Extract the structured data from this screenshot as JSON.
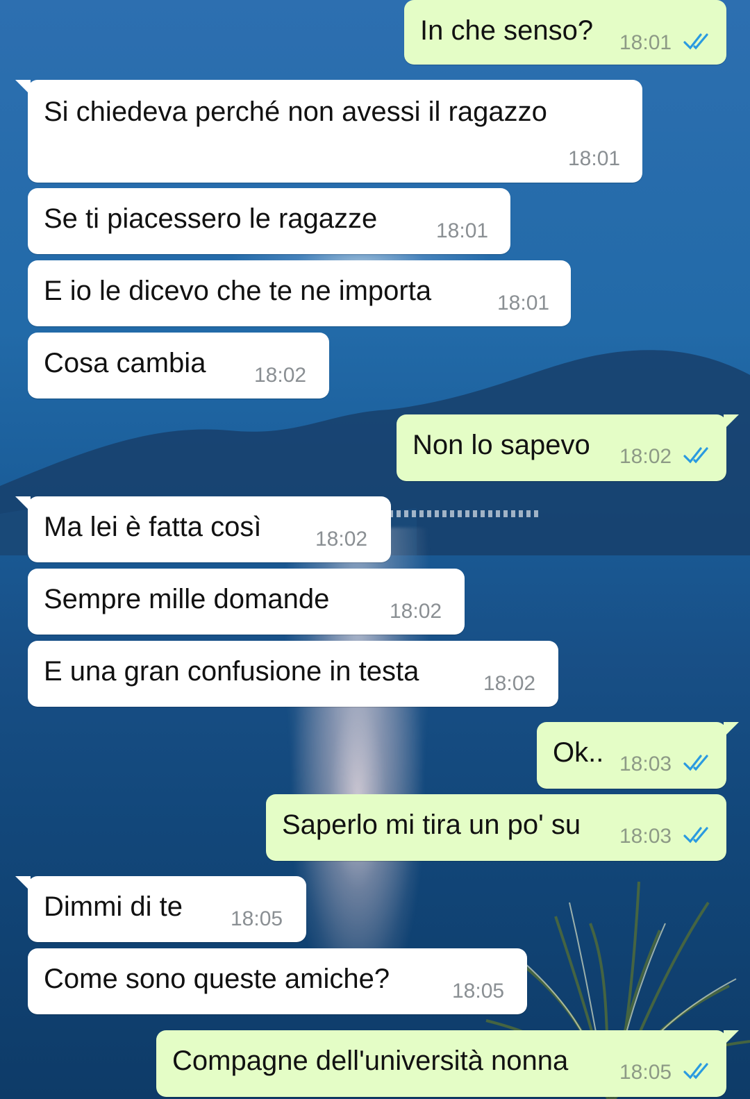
{
  "colors": {
    "incoming_bubble": "#ffffff",
    "outgoing_bubble": "#e4fdc6",
    "read_ticks": "#2a9ae0",
    "time_text": "#8a8f93"
  },
  "icons": {
    "read_receipt": "double-check-icon"
  },
  "messages": [
    {
      "direction": "out",
      "text": "In che senso?",
      "time": "18:01",
      "status": "read"
    },
    {
      "direction": "in",
      "text": "Si chiedeva perché non avessi il ragazzo",
      "time": "18:01"
    },
    {
      "direction": "in",
      "text": "Se ti piacessero le ragazze",
      "time": "18:01"
    },
    {
      "direction": "in",
      "text": "E io le dicevo che te ne importa",
      "time": "18:01"
    },
    {
      "direction": "in",
      "text": "Cosa cambia",
      "time": "18:02"
    },
    {
      "direction": "out",
      "text": "Non lo sapevo",
      "time": "18:02",
      "status": "read"
    },
    {
      "direction": "in",
      "text": "Ma lei è fatta così",
      "time": "18:02"
    },
    {
      "direction": "in",
      "text": "Sempre mille domande",
      "time": "18:02"
    },
    {
      "direction": "in",
      "text": "E una gran confusione in testa",
      "time": "18:02"
    },
    {
      "direction": "out",
      "text": "Ok..",
      "time": "18:03",
      "status": "read"
    },
    {
      "direction": "out",
      "text": "Saperlo mi tira un po' su",
      "time": "18:03",
      "status": "read"
    },
    {
      "direction": "in",
      "text": "Dimmi di te",
      "time": "18:05"
    },
    {
      "direction": "in",
      "text": "Come sono queste amiche?",
      "time": "18:05"
    },
    {
      "direction": "out",
      "text": "Compagne dell'università nonna",
      "time": "18:05",
      "status": "read"
    }
  ]
}
